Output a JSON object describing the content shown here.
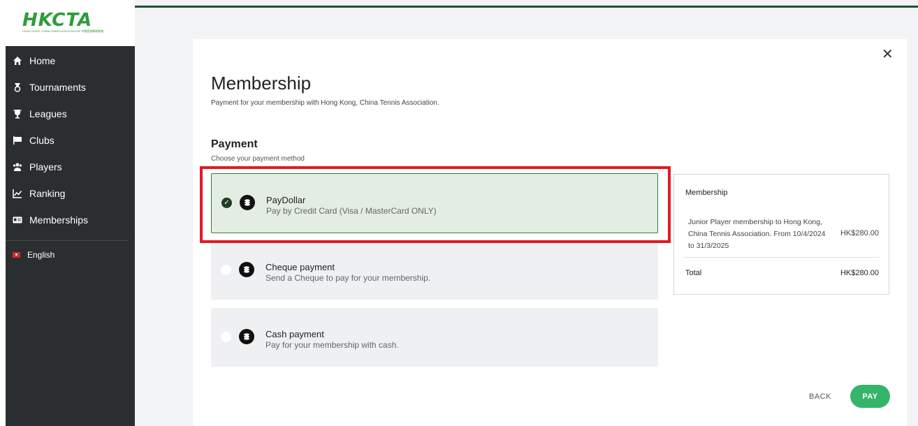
{
  "brand": {
    "logo_text": "HKCTA",
    "logo_subtext": "HONG KONG, CHINA TENNIS ASSOCIATION 中國香港網球總會",
    "accent": "#2e9b3a",
    "dark": "#2b2e30"
  },
  "sidebar": {
    "items": [
      {
        "label": "Home",
        "icon": "home-icon"
      },
      {
        "label": "Tournaments",
        "icon": "medal-icon"
      },
      {
        "label": "Leagues",
        "icon": "trophy-icon"
      },
      {
        "label": "Clubs",
        "icon": "flag-icon"
      },
      {
        "label": "Players",
        "icon": "users-icon"
      },
      {
        "label": "Ranking",
        "icon": "chart-line-icon"
      },
      {
        "label": "Memberships",
        "icon": "id-card-icon"
      }
    ],
    "language": "English"
  },
  "modal": {
    "close_glyph": "✕",
    "title": "Membership",
    "subtitle": "Payment for your membership with Hong Kong, China Tennis Association.",
    "payment_title": "Payment",
    "payment_sub": "Choose your payment method",
    "options": [
      {
        "name": "PayDollar",
        "desc": "Pay by Credit Card (Visa / MasterCard ONLY)",
        "selected": true
      },
      {
        "name": "Cheque payment",
        "desc": "Send a Cheque to pay for your membership.",
        "selected": false
      },
      {
        "name": "Cash payment",
        "desc": "Pay for your membership with cash.",
        "selected": false
      }
    ],
    "summary": {
      "heading": "Membership",
      "item_desc": "Junior Player membership to Hong Kong, China Tennis Association. From 10/4/2024 to 31/3/2025",
      "item_price": "HK$280.00",
      "total_label": "Total",
      "total_value": "HK$280.00"
    },
    "back_label": "BACK",
    "pay_label": "PAY"
  }
}
